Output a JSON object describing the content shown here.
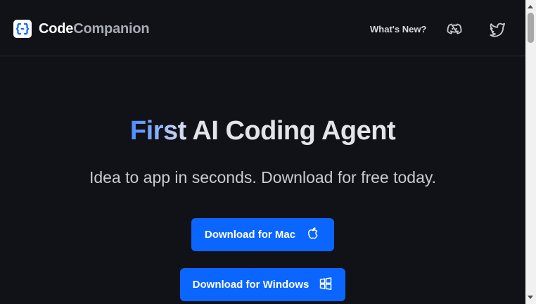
{
  "brand": {
    "name_part1": "Code",
    "name_part2": "Companion",
    "logo_icon": "bracket-logo-icon"
  },
  "nav": {
    "whats_new": "What's New?",
    "discord_icon": "discord-icon",
    "twitter_icon": "twitter-icon"
  },
  "hero": {
    "headline_gradient": "First",
    "headline_rest": " AI Coding Agent",
    "subhead": "Idea to app in seconds. Download for free today."
  },
  "buttons": {
    "mac": {
      "label": "Download for Mac",
      "icon": "apple-icon"
    },
    "windows": {
      "label": "Download for Windows",
      "icon": "windows-icon"
    }
  },
  "colors": {
    "background": "#111218",
    "accent": "#0a66ff",
    "muted": "#a8abb3"
  }
}
